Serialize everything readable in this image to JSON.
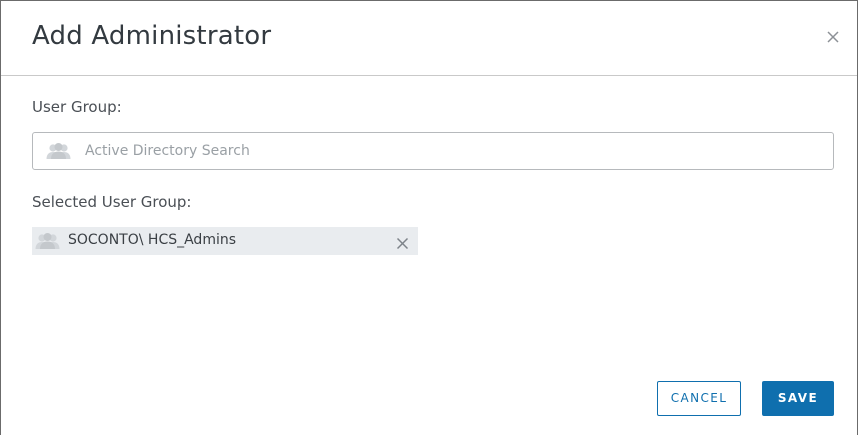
{
  "dialog": {
    "title": "Add Administrator"
  },
  "user_group": {
    "label": "User Group:",
    "search_placeholder": "Active Directory Search",
    "search_value": ""
  },
  "selected_user_group": {
    "label": "Selected User Group:",
    "items": [
      {
        "name": "SOCONTO\\ HCS_Admins"
      }
    ]
  },
  "buttons": {
    "cancel_label": "CANCEL",
    "save_label": "SAVE"
  },
  "icons": {
    "close": "close-icon",
    "group": "user-group-icon",
    "remove": "remove-icon"
  },
  "colors": {
    "accent": "#0f6fae",
    "chip_background": "#e9ecef",
    "icon_gray": "#c4c8cc"
  }
}
